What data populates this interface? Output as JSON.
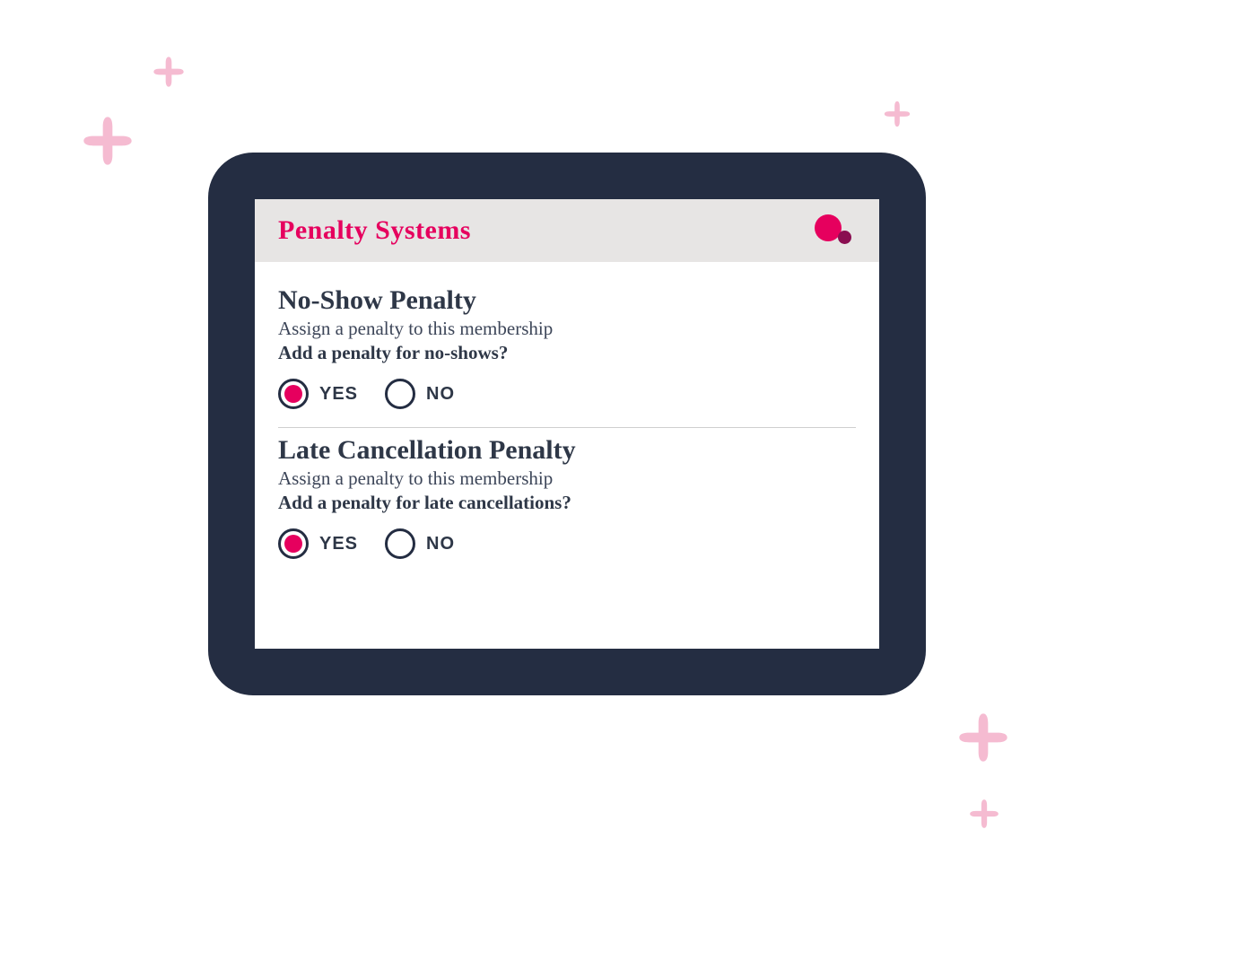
{
  "colors": {
    "navy": "#242D42",
    "magenta": "#E6005E",
    "deep_magenta": "#8A0E51",
    "light_pink": "#F5BBD1",
    "header_grey": "#E7E5E4"
  },
  "header": {
    "title": "Penalty Systems",
    "logo": "two-circles-icon"
  },
  "sections": [
    {
      "title": "No-Show Penalty",
      "subtitle": "Assign a penalty to this membership",
      "prompt": "Add a penalty for no-shows?",
      "options": {
        "yes": "YES",
        "no": "NO"
      },
      "selected": "yes"
    },
    {
      "title": "Late Cancellation Penalty",
      "subtitle": "Assign a penalty to this membership",
      "prompt": "Add a penalty for late cancellations?",
      "options": {
        "yes": "YES",
        "no": "NO"
      },
      "selected": "yes"
    }
  ]
}
